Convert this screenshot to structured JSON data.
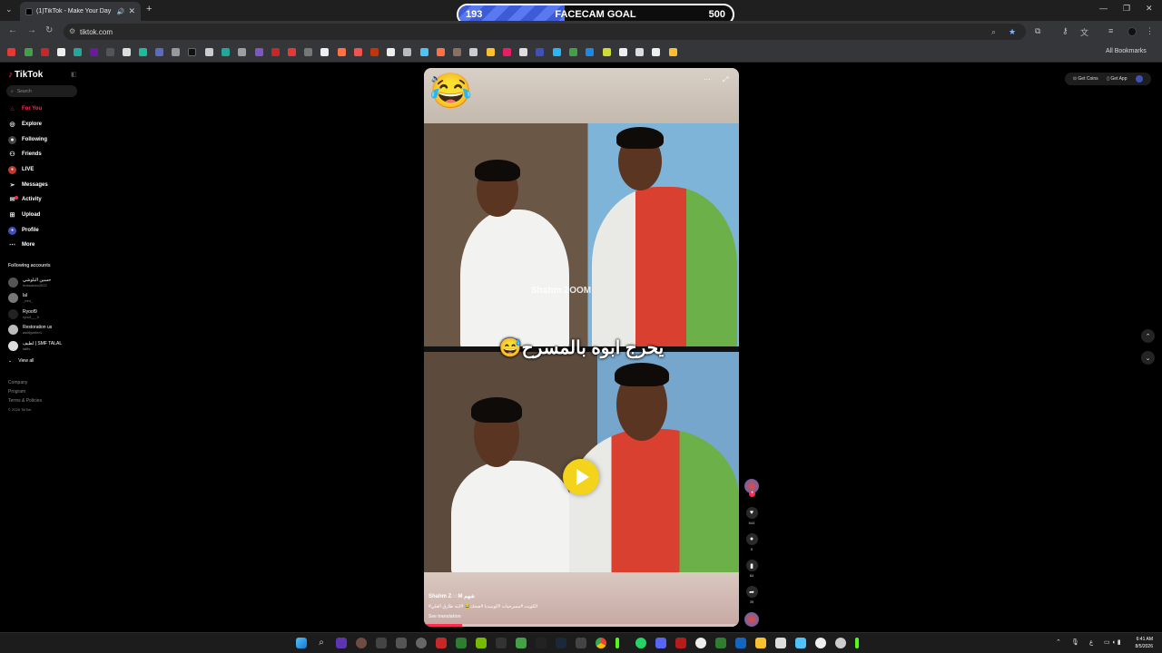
{
  "browser": {
    "tab_title": "(1)TikTok - Make Your Day",
    "tab_close": "✕",
    "new_tab": "+",
    "url": "tiktok.com",
    "all_bookmarks": "All Bookmarks"
  },
  "goal": {
    "current": "193",
    "label": "FACECAM GOAL",
    "target": "500",
    "progress_fraction": 0.386,
    "fill_color": "#3d5bd6"
  },
  "sidebar": {
    "logo": "TikTok",
    "search_placeholder": "Search",
    "nav": [
      {
        "label": "For You",
        "icon": "home-icon",
        "active": true
      },
      {
        "label": "Explore",
        "icon": "compass-icon"
      },
      {
        "label": "Following",
        "icon": "following-icon"
      },
      {
        "label": "Friends",
        "icon": "friends-icon"
      },
      {
        "label": "LIVE",
        "icon": "live-icon"
      },
      {
        "label": "Messages",
        "icon": "messages-icon"
      },
      {
        "label": "Activity",
        "icon": "activity-icon"
      },
      {
        "label": "Upload",
        "icon": "upload-icon"
      },
      {
        "label": "Profile",
        "icon": "profile-icon"
      },
      {
        "label": "More",
        "icon": "more-icon"
      }
    ],
    "following_title": "Following accounts",
    "accounts": [
      {
        "name": "حسين البلوشي",
        "handle": "hussainxx2022"
      },
      {
        "name": "lal",
        "handle": "_mnl_"
      },
      {
        "name": "Ryoof9",
        "handle": "ryoof___9"
      },
      {
        "name": "Restoration us",
        "handle": "asdfgunter1"
      },
      {
        "name": "لطيف | SMF TALAL",
        "handle": "talfls"
      }
    ],
    "view_all": "View all",
    "footer": [
      "Company",
      "Program",
      "Terms & Policies",
      "© 2026 TikTok"
    ]
  },
  "video": {
    "caption_overlay": "يحرج ابوه بالمسرح😅",
    "watermark": "Shahm ZOOM",
    "author": "Shahm Z◌◌M شهم",
    "description": "#الكويت #مسرحيات #كوميديا #ضحك😂 #ابنه طارق العلي",
    "see_translation": "See translation",
    "progress_fraction": 0.12,
    "emoji": "😂"
  },
  "actions": {
    "likes": "644",
    "comments": "5",
    "saves": "84",
    "shares": "39"
  },
  "topright": {
    "get_coins": "Get Coins",
    "get_app": "Get App"
  },
  "taskbar": {
    "time": "6:41 AM",
    "date": "8/5/2026",
    "lang": "ع"
  }
}
